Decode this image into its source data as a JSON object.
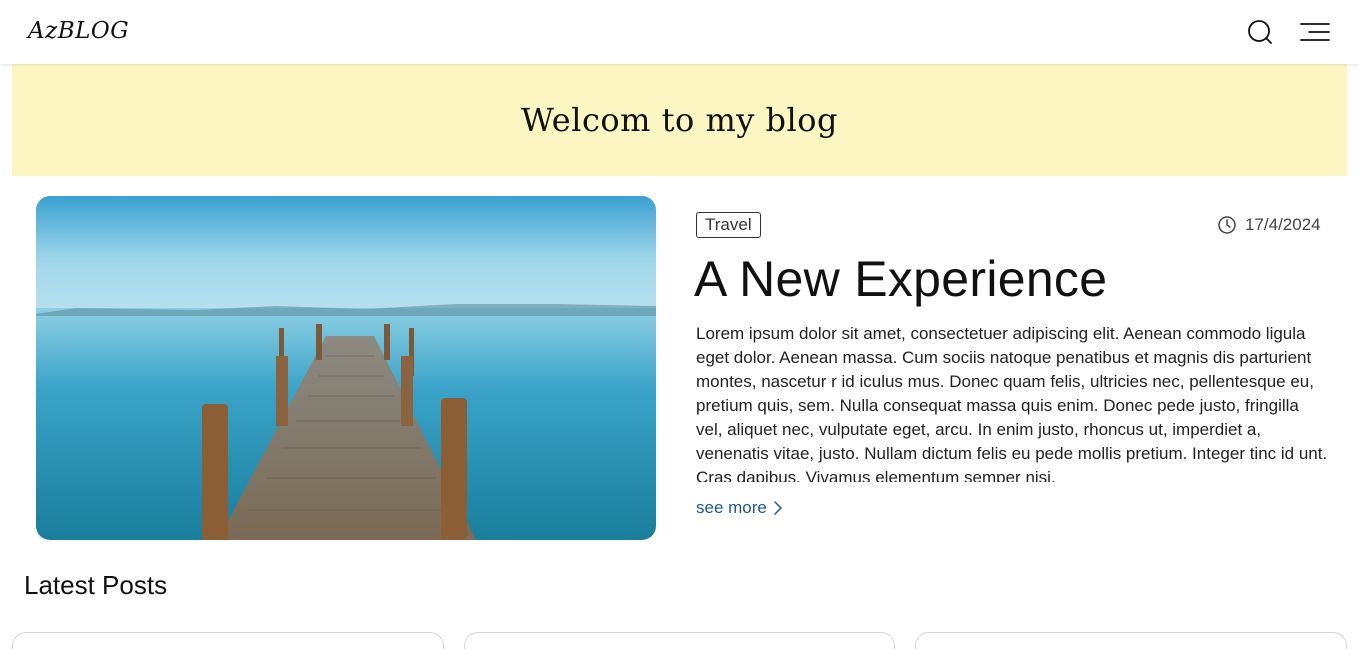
{
  "header": {
    "logo": "AzBLOG",
    "search_icon": "search-icon",
    "menu_icon": "menu-icon"
  },
  "banner": {
    "title": "Welcom to my blog",
    "background": "#fcf7c2"
  },
  "featured": {
    "category": "Travel",
    "date": "17/4/2024",
    "date_icon": "clock-icon",
    "title": "A New Experience",
    "excerpt": "Lorem ipsum dolor sit amet, consectetuer adipiscing elit. Aenean commodo ligula eget dolor. Aenean massa. Cum sociis natoque penatibus et magnis dis parturient montes, nascetur r id iculus mus. Donec quam felis, ultricies nec, pellentesque eu, pretium quis, sem. Nulla consequat massa quis enim. Donec pede justo, fringilla vel, aliquet nec, vulputate eget, arcu. In enim justo, rhoncus ut, imperdiet a, venenatis vitae, justo. Nullam dictum felis eu pede mollis pretium. Integer tinc id unt. Cras dapibus. Vivamus elementum semper nisi.",
    "see_more": "see more",
    "image": "wooden-pier-lake-photo"
  },
  "latest": {
    "title": "Latest Posts"
  },
  "colors": {
    "link": "#1f5a8c"
  }
}
